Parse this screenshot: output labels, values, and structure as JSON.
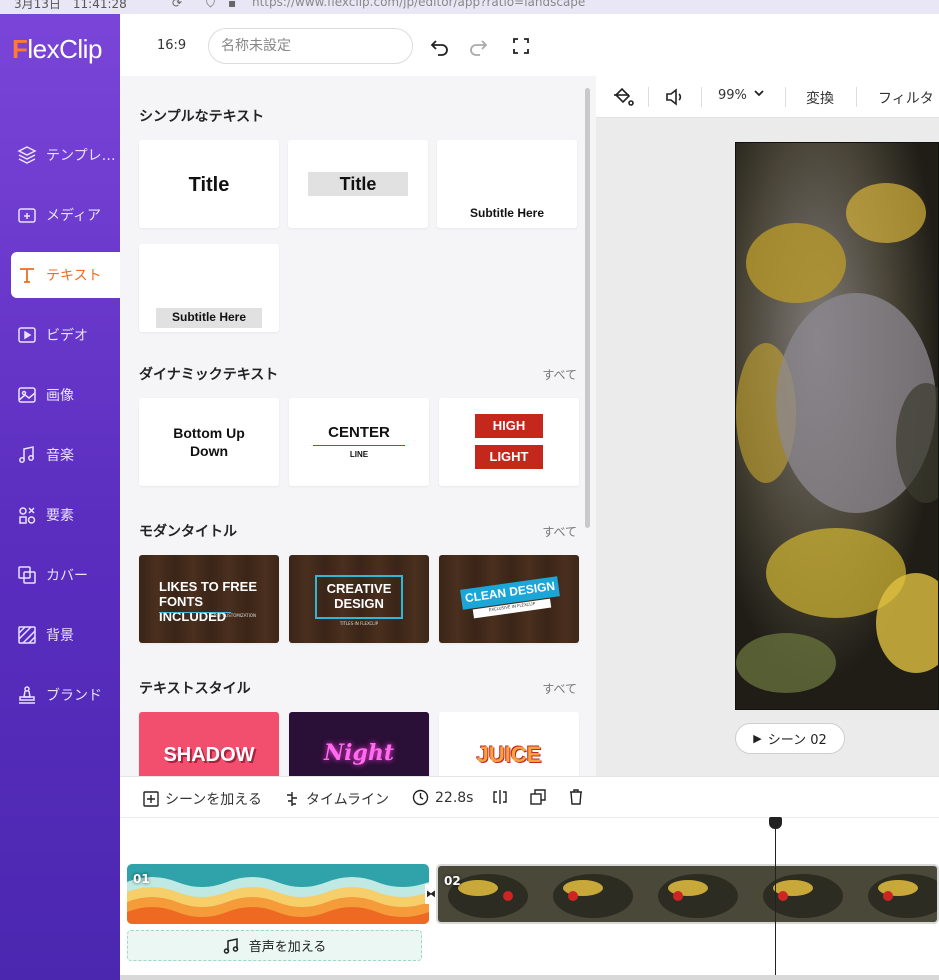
{
  "browser": {
    "time": "3月13日　11:41:28",
    "url": "https://www.flexclip.com/jp/editor/app?ratio=landscape"
  },
  "sidebar": {
    "logo_f": "F",
    "logo_rest": "lexClip",
    "items": [
      {
        "label": "テンプレ…",
        "icon": "layers-icon"
      },
      {
        "label": "メディア",
        "icon": "media-icon"
      },
      {
        "label": "テキスト",
        "icon": "text-icon"
      },
      {
        "label": "ビデオ",
        "icon": "video-icon"
      },
      {
        "label": "画像",
        "icon": "image-icon"
      },
      {
        "label": "音楽",
        "icon": "music-icon"
      },
      {
        "label": "要素",
        "icon": "elements-icon"
      },
      {
        "label": "カバー",
        "icon": "cover-icon"
      },
      {
        "label": "背景",
        "icon": "background-icon"
      },
      {
        "label": "ブランド",
        "icon": "brand-icon"
      }
    ],
    "active_index": 2
  },
  "topbar": {
    "ratio": "16:9",
    "name_placeholder": "名称未設定"
  },
  "panel": {
    "simple": {
      "title": "シンプルなテキスト",
      "cards": [
        "Title",
        "Title",
        "Subtitle Here",
        "Subtitle Here"
      ]
    },
    "dynamic": {
      "title": "ダイナミックテキスト",
      "all": "すべて",
      "card1": "Bottom Up\nDown",
      "card2_main": "CENTER",
      "card2_sub": "LINE",
      "card3_top": "HIGH",
      "card3_bottom": "LIGHT"
    },
    "modern": {
      "title": "モダンタイトル",
      "all": "すべて",
      "card1_main": "LIKES TO FREE\nFONTS INCLUDED",
      "card1_sub": "EASY CUSTOMIZATION",
      "card2_main": "CREATIVE\nDESIGN",
      "card2_sub": "TITLES IN FLEXCLIP",
      "card3_main": "CLEAN DESIGN",
      "card3_sub": "EXCLUSIVE IN FLEXCLIP"
    },
    "style": {
      "title": "テキストスタイル",
      "all": "すべて",
      "card1": "SHADOW",
      "card2": "Night",
      "card3": "JUICE"
    }
  },
  "canvas": {
    "zoom": "99%",
    "transform": "変換",
    "filter": "フィルタ",
    "scene_button": "シーン 02"
  },
  "timeline": {
    "add_scene": "シーンを加える",
    "timeline": "タイムライン",
    "duration": "22.8s",
    "clip1_label": "01",
    "clip2_label": "02",
    "add_audio": "音声を加える"
  },
  "colors": {
    "accent": "#f26b21",
    "sidebar_top": "#7a45d8",
    "sidebar_bottom": "#4b27b0"
  }
}
